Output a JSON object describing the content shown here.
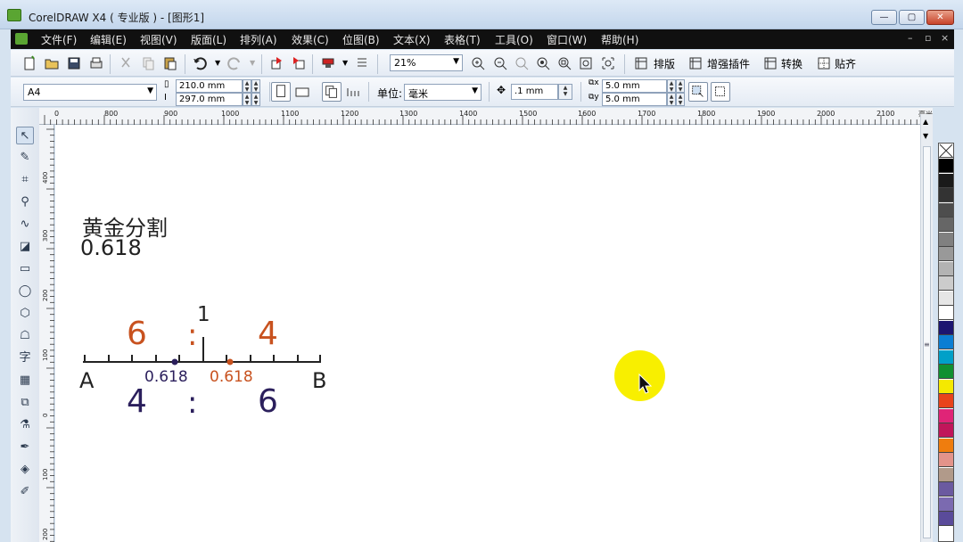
{
  "window": {
    "title": "CorelDRAW X4 ( 专业版 ) - [图形1]",
    "controls": {
      "minimize": "—",
      "maximize": "▢",
      "close": "✕"
    }
  },
  "menu": {
    "items": [
      "文件(F)",
      "编辑(E)",
      "视图(V)",
      "版面(L)",
      "排列(A)",
      "效果(C)",
      "位图(B)",
      "文本(X)",
      "表格(T)",
      "工具(O)",
      "窗口(W)",
      "帮助(H)"
    ],
    "doc_controls": [
      "–",
      "▫",
      "×"
    ]
  },
  "toolbar": {
    "zoom": "21%",
    "dock_labels": [
      "排版",
      "增强插件",
      "转换",
      "贴齐"
    ]
  },
  "property_bar": {
    "page_size": "A4",
    "width": "210.0 mm",
    "height": "297.0 mm",
    "units_label": "单位:",
    "units_value": "毫米",
    "nudge": ".1 mm",
    "dup_x": "5.0 mm",
    "dup_y": "5.0 mm"
  },
  "rulers": {
    "top_labels": [
      "0",
      "800",
      "900",
      "1000",
      "1100",
      "1200",
      "1300",
      "1400",
      "1500",
      "1600",
      "1700",
      "1800",
      "1900",
      "2000",
      "2100"
    ],
    "top_unit": "毫米",
    "left_labels": [
      "400",
      "300",
      "200",
      "100",
      "0",
      "100",
      "200"
    ]
  },
  "canvas": {
    "title": "黄金分割",
    "value": "0.618",
    "top_left_num": "6",
    "top_colon": ":",
    "top_right_num": "4",
    "top_one": "1",
    "label_a": "A",
    "label_b": "B",
    "left_ratio": "0.618",
    "right_ratio": "0.618",
    "bottom_left_num": "4",
    "bottom_colon": ":",
    "bottom_right_num": "6"
  },
  "colors": {
    "orange": "#c8521f",
    "purple": "#2b1f5c",
    "cursor_highlight": "#f8ef00"
  },
  "palette": [
    "#000000",
    "#1a1a1a",
    "#333333",
    "#4d4d4d",
    "#666666",
    "#808080",
    "#999999",
    "#b3b3b3",
    "#cccccc",
    "#e6e6e6",
    "#ffffff",
    "#1c1570",
    "#0b7ed3",
    "#00a0c8",
    "#109030",
    "#f5e900",
    "#e8431b",
    "#e02477",
    "#c0165a",
    "#ef7d0e",
    "#e3938a",
    "#b19a8a",
    "#6b5aa0",
    "#7b6ab0",
    "#5a4b9a"
  ]
}
